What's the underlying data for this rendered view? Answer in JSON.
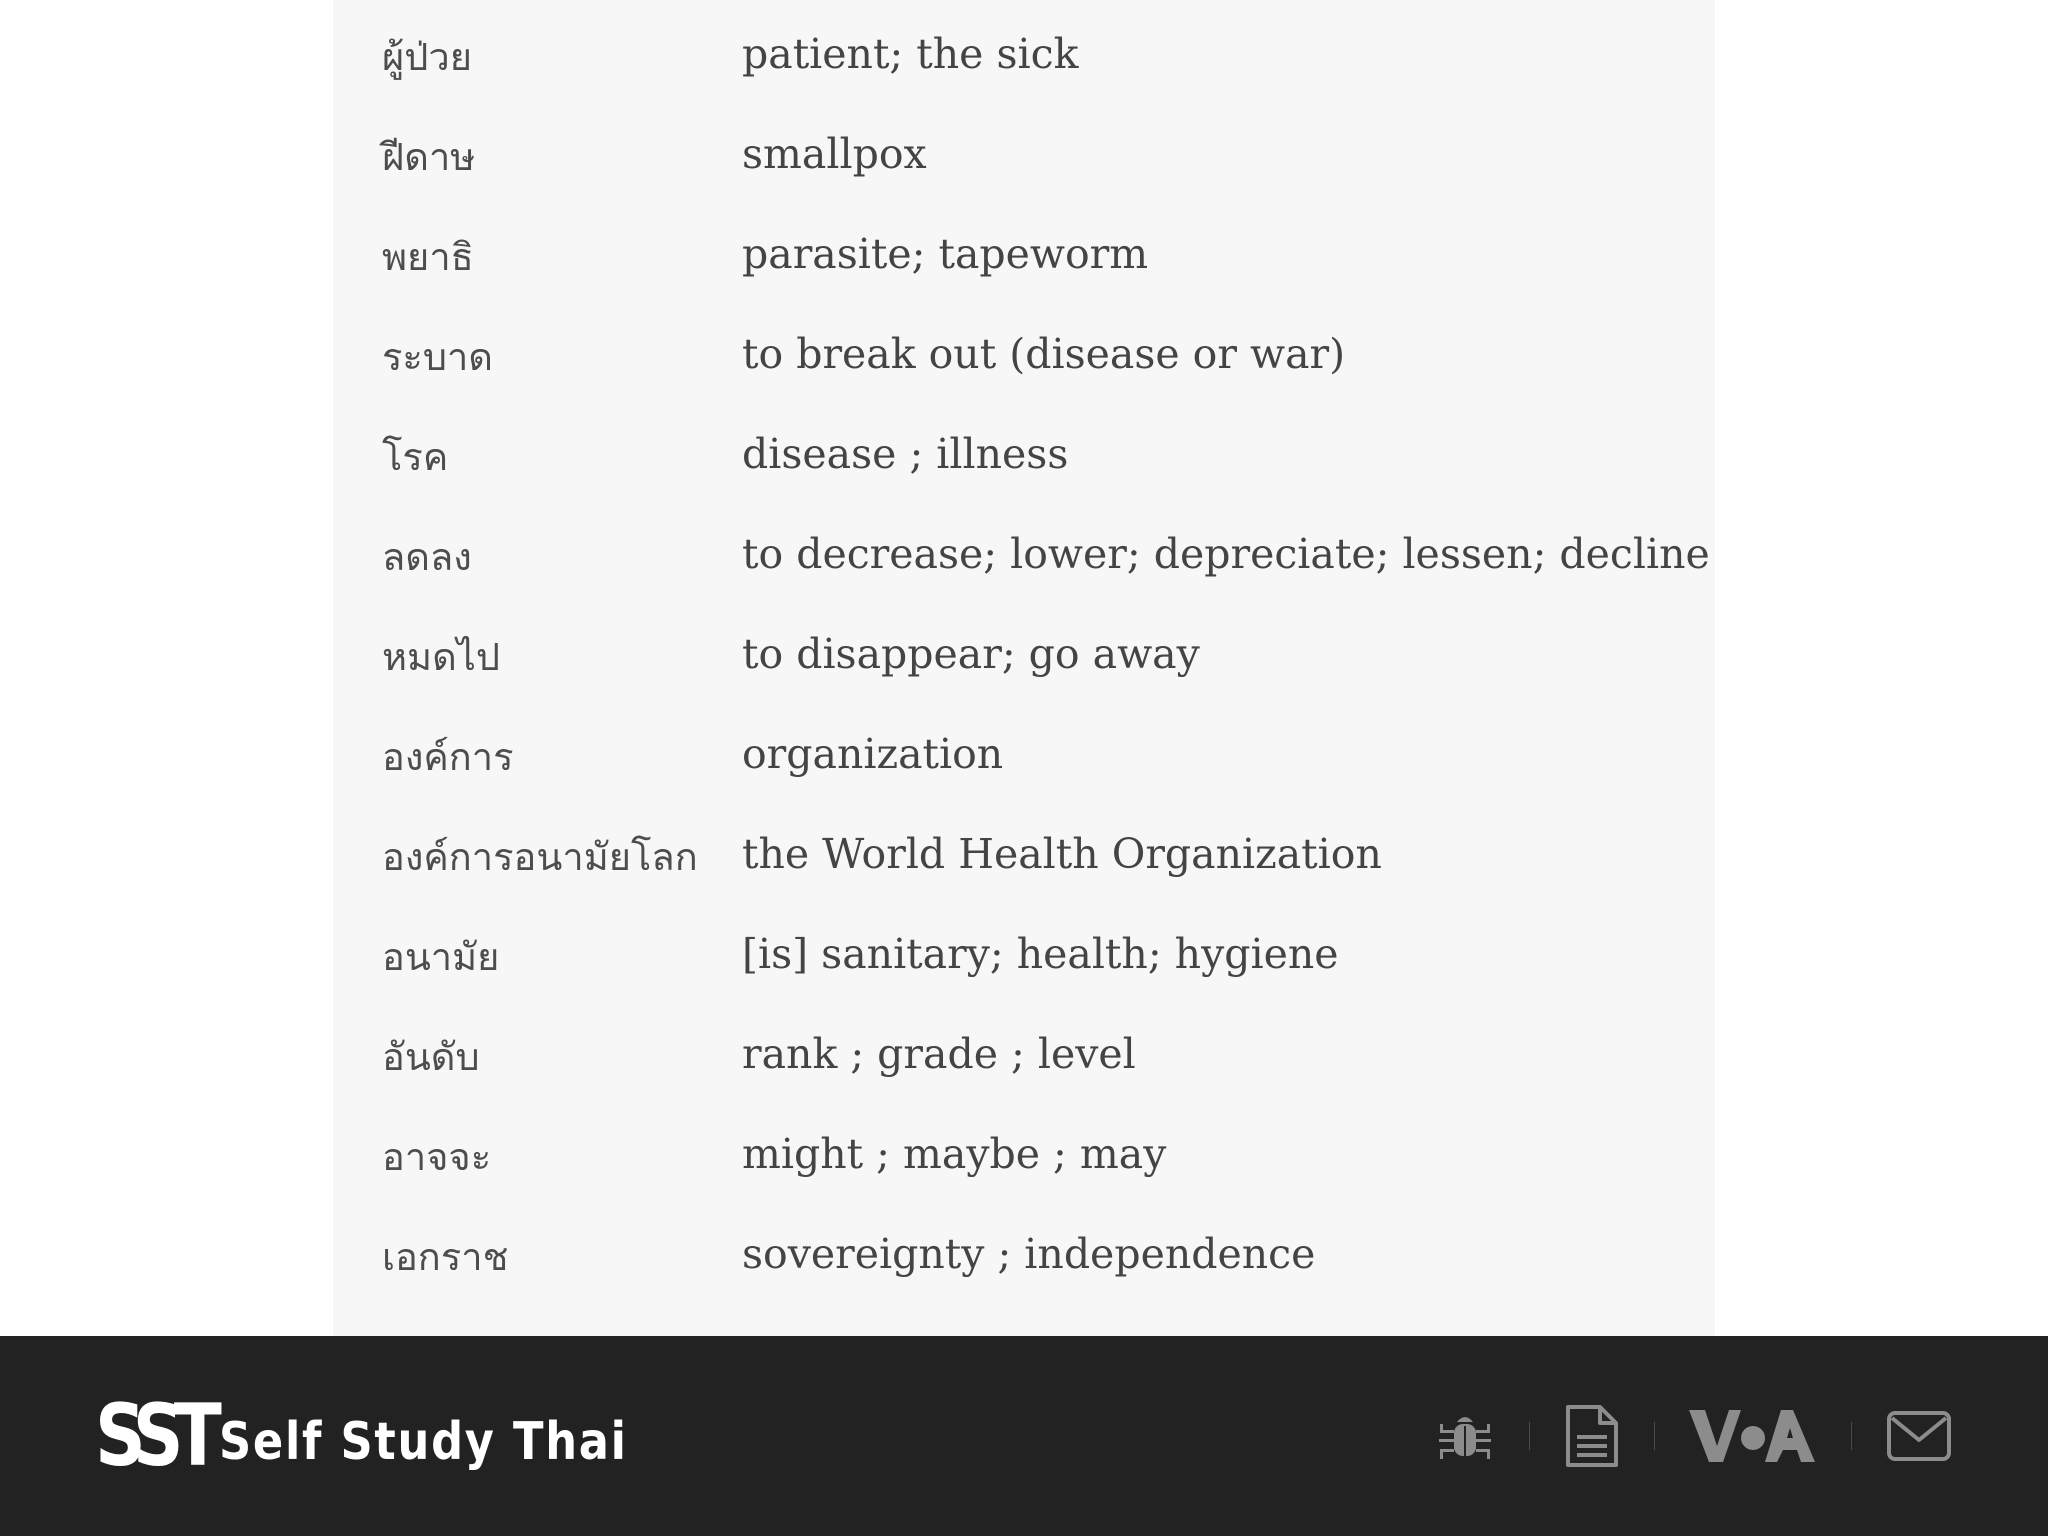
{
  "vocabulary": [
    {
      "thai": "ผู้ป่วย",
      "english": "patient; the sick"
    },
    {
      "thai": "ฝีดาษ",
      "english": "smallpox"
    },
    {
      "thai": "พยาธิ",
      "english": "parasite; tapeworm"
    },
    {
      "thai": "ระบาด",
      "english": "to break out (disease or war)"
    },
    {
      "thai": "โรค",
      "english": "disease ; illness"
    },
    {
      "thai": "ลดลง",
      "english": "to decrease; lower; depreciate; lessen; decline"
    },
    {
      "thai": "หมดไป",
      "english": "to disappear; go away"
    },
    {
      "thai": "องค์การ",
      "english": "organization"
    },
    {
      "thai": "องค์การอนามัยโลก",
      "english": "the World Health Organization"
    },
    {
      "thai": "อนามัย",
      "english": "[is] sanitary; health; hygiene"
    },
    {
      "thai": "อันดับ",
      "english": "rank ; grade ; level"
    },
    {
      "thai": "อาจจะ",
      "english": "might ; maybe ; may"
    },
    {
      "thai": "เอกราช",
      "english": "sovereignty ; independence"
    }
  ],
  "footer": {
    "logo_mark": "SST",
    "logo_text": "Self Study Thai",
    "icons": [
      "bug-icon",
      "document-icon",
      "voa-icon",
      "mail-icon"
    ],
    "background_color": "#222222",
    "icon_color": "#8c8c8c"
  }
}
